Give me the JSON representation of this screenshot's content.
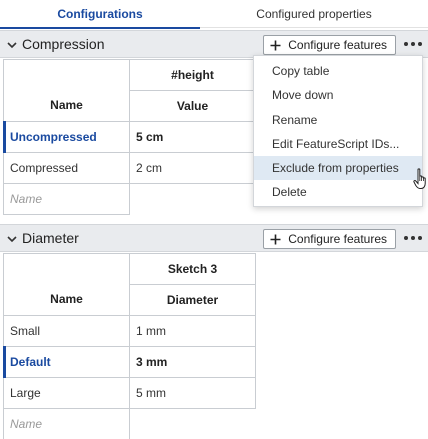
{
  "tabs": [
    "Configurations",
    "Configured properties"
  ],
  "sections": [
    {
      "title": "Compression",
      "configure_label": "Configure features",
      "columns": {
        "name_header": "Name",
        "group_header": "#height",
        "value_header": "Value"
      },
      "rows": [
        {
          "name": "Uncompressed",
          "value": "5 cm",
          "selected": true
        },
        {
          "name": "Compressed",
          "value": "2 cm",
          "selected": false
        }
      ],
      "name_placeholder": "Name"
    },
    {
      "title": "Diameter",
      "configure_label": "Configure features",
      "columns": {
        "name_header": "Name",
        "group_header": "Sketch 3",
        "value_header": "Diameter"
      },
      "rows": [
        {
          "name": "Small",
          "value": "1 mm",
          "selected": false
        },
        {
          "name": "Default",
          "value": "3 mm",
          "selected": true
        },
        {
          "name": "Large",
          "value": "5 mm",
          "selected": false
        }
      ],
      "name_placeholder": "Name"
    }
  ],
  "context_menu": {
    "items": [
      "Copy table",
      "Move down",
      "Rename",
      "Edit FeatureScript IDs...",
      "Exclude from properties",
      "Delete"
    ],
    "highlighted": "Exclude from properties"
  },
  "icons": {
    "section_toggle": "chevron-down-icon",
    "configure": "plus-icon",
    "overflow": "more-icon",
    "pointer": "hand-cursor-icon"
  },
  "colors": {
    "accent": "#1a4aa0",
    "header_bg": "#e9ebee",
    "menu_highlight": "#dfe9f3"
  }
}
